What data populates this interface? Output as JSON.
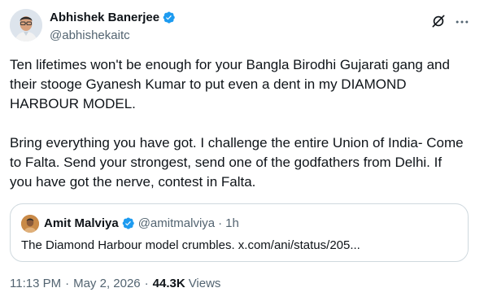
{
  "author": {
    "display_name": "Abhishek Banerjee",
    "handle": "@abhishekaitc"
  },
  "icons": {
    "verified": "verified-badge-icon",
    "grok": "grok-icon",
    "more": "more-options-icon"
  },
  "tweet": {
    "paragraphs": [
      "Ten lifetimes won't be enough for your Bangla Birodhi Gujarati gang and their stooge Gyanesh Kumar to put even a dent in my DIAMOND HARBOUR MODEL.",
      "Bring everything you have got. I challenge the entire Union of India- Come to Falta. Send your strongest, send one of the godfathers from Delhi. If you have got the nerve, contest in Falta."
    ]
  },
  "quote": {
    "display_name": "Amit Malviya",
    "handle": "@amitmalviya",
    "separator": "·",
    "time": "1h",
    "text": "The Diamond Harbour model crumbles. x.com/ani/status/205..."
  },
  "meta": {
    "time": "11:13 PM",
    "separator": "·",
    "date": "May 2, 2026",
    "views_count": "44.3K",
    "views_label": "Views"
  },
  "colors": {
    "text_primary": "#0f1419",
    "text_secondary": "#536471",
    "verified_blue": "#1d9bf0",
    "border": "#cfd9de"
  }
}
